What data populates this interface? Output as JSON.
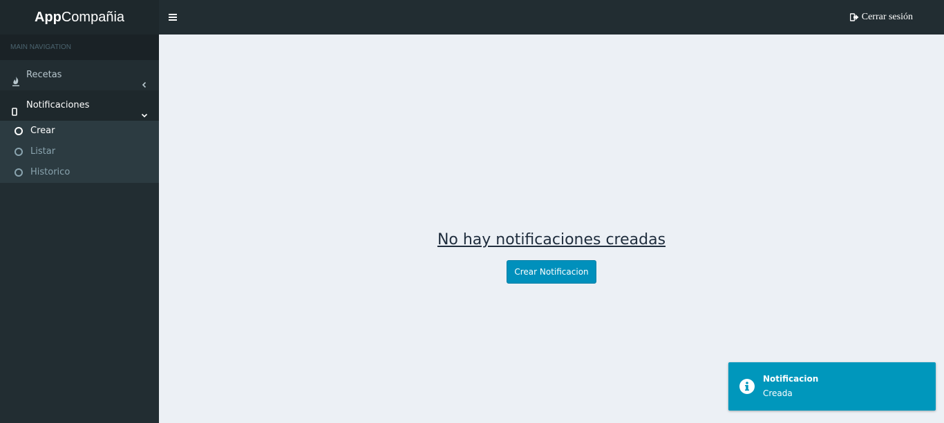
{
  "header": {
    "logo_bold": "App",
    "logo_light": "Compañia",
    "logout_label": "Cerrar sesión"
  },
  "sidebar": {
    "nav_header": "MAIN NAVIGATION",
    "items": [
      {
        "label": "Recetas",
        "icon": "fire-icon",
        "expanded": false
      },
      {
        "label": "Notificaciones",
        "icon": "mobile-icon",
        "expanded": true,
        "subitems": [
          {
            "label": "Crear",
            "active": true
          },
          {
            "label": "Listar",
            "active": false
          },
          {
            "label": "Historico",
            "active": false
          }
        ]
      }
    ]
  },
  "main": {
    "empty_message": "No hay notificaciones creadas",
    "create_button_label": "Crear Notificacion"
  },
  "toast": {
    "title": "Notificacion",
    "message": "Creada",
    "icon": "info-circle-icon"
  },
  "colors": {
    "header_bg": "#222d32",
    "logo_bg": "#1e282c",
    "content_bg": "#ecf0f5",
    "accent": "#0090bc",
    "toast_bg": "#0097bc"
  }
}
